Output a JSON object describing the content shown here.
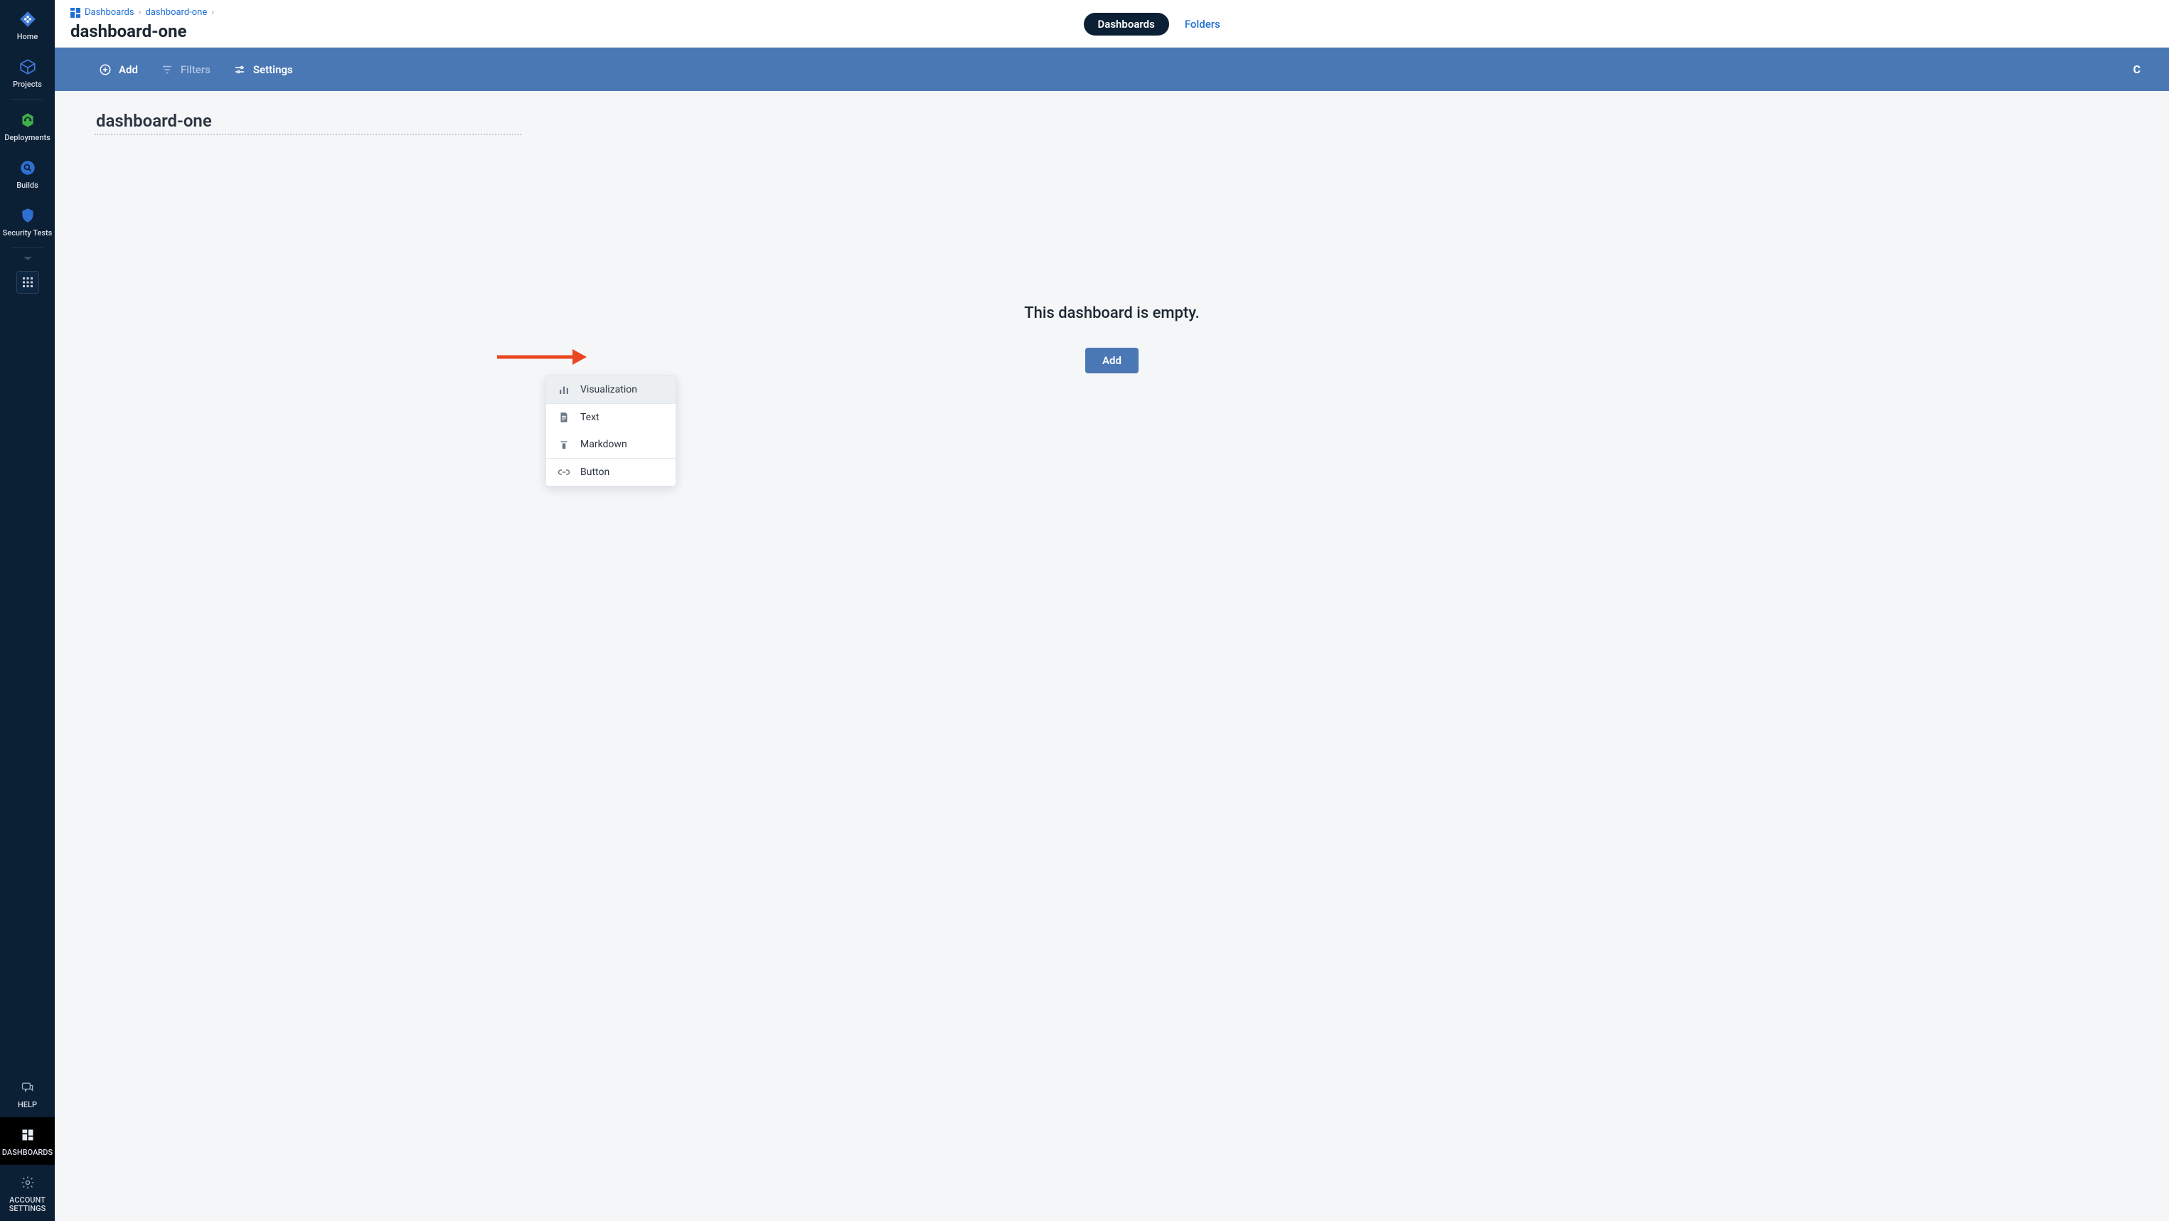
{
  "sidebar": {
    "items": [
      {
        "label": "Home"
      },
      {
        "label": "Projects"
      },
      {
        "label": "Deployments"
      },
      {
        "label": "Builds"
      },
      {
        "label": "Security Tests"
      }
    ],
    "help_label": "HELP",
    "dashboards_label": "DASHBOARDS",
    "account_settings_label": "ACCOUNT\nSETTINGS"
  },
  "breadcrumbs": {
    "root": "Dashboards",
    "current": "dashboard-one"
  },
  "page_title": "dashboard-one",
  "tabs": {
    "dashboards": "Dashboards",
    "folders": "Folders"
  },
  "toolbar": {
    "add": "Add",
    "filters": "Filters",
    "settings": "Settings",
    "right_letter": "C"
  },
  "editor": {
    "title_value": "dashboard-one"
  },
  "empty": {
    "message": "This dashboard is empty.",
    "add_label": "Add"
  },
  "dropdown": {
    "visualization": "Visualization",
    "text": "Text",
    "markdown": "Markdown",
    "button": "Button"
  },
  "colors": {
    "sidebar_bg": "#0b1f35",
    "toolbar_bg": "#4a78b5",
    "link": "#1f6fd6",
    "arrow": "#e8471f"
  }
}
